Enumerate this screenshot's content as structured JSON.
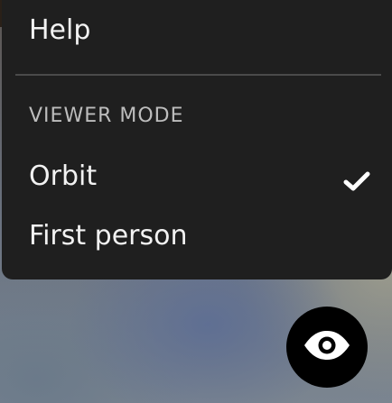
{
  "menu": {
    "help_label": "Help",
    "section_title": "VIEWER MODE",
    "items": [
      {
        "label": "Orbit",
        "selected": true
      },
      {
        "label": "First person",
        "selected": false
      }
    ]
  },
  "icons": {
    "check": "check-icon",
    "viewer_toggle": "eye-icon"
  },
  "colors": {
    "menu_background": "#1f1f1f",
    "menu_text": "#f2f2f2",
    "section_text": "#bdbdbd",
    "button_background": "#000000"
  }
}
